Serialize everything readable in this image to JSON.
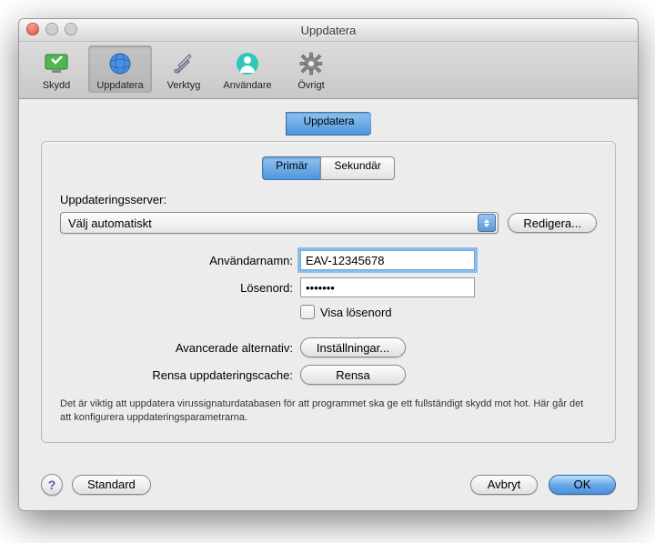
{
  "window_title": "Uppdatera",
  "toolbar": {
    "items": [
      {
        "label": "Skydd"
      },
      {
        "label": "Uppdatera"
      },
      {
        "label": "Verktyg"
      },
      {
        "label": "Användare"
      },
      {
        "label": "Övrigt"
      }
    ]
  },
  "main_tab": {
    "label": "Uppdatera"
  },
  "sub_tabs": {
    "primary": "Primär",
    "secondary": "Sekundär"
  },
  "server": {
    "label": "Uppdateringsserver:",
    "value": "Välj automatiskt",
    "edit_btn": "Redigera..."
  },
  "username": {
    "label": "Användarnamn:",
    "value": "EAV-12345678"
  },
  "password": {
    "label": "Lösenord:",
    "value": "•••••••"
  },
  "show_password": "Visa lösenord",
  "advanced": {
    "label": "Avancerade alternativ:",
    "btn": "Inställningar..."
  },
  "clear_cache": {
    "label": "Rensa uppdateringscache:",
    "btn": "Rensa"
  },
  "info": "Det är viktig att uppdatera virussignaturdatabasen för att programmet ska ge ett fullständigt skydd mot hot. Här går det att konfigurera uppdateringsparametrarna.",
  "footer": {
    "standard": "Standard",
    "cancel": "Avbryt",
    "ok": "OK"
  }
}
